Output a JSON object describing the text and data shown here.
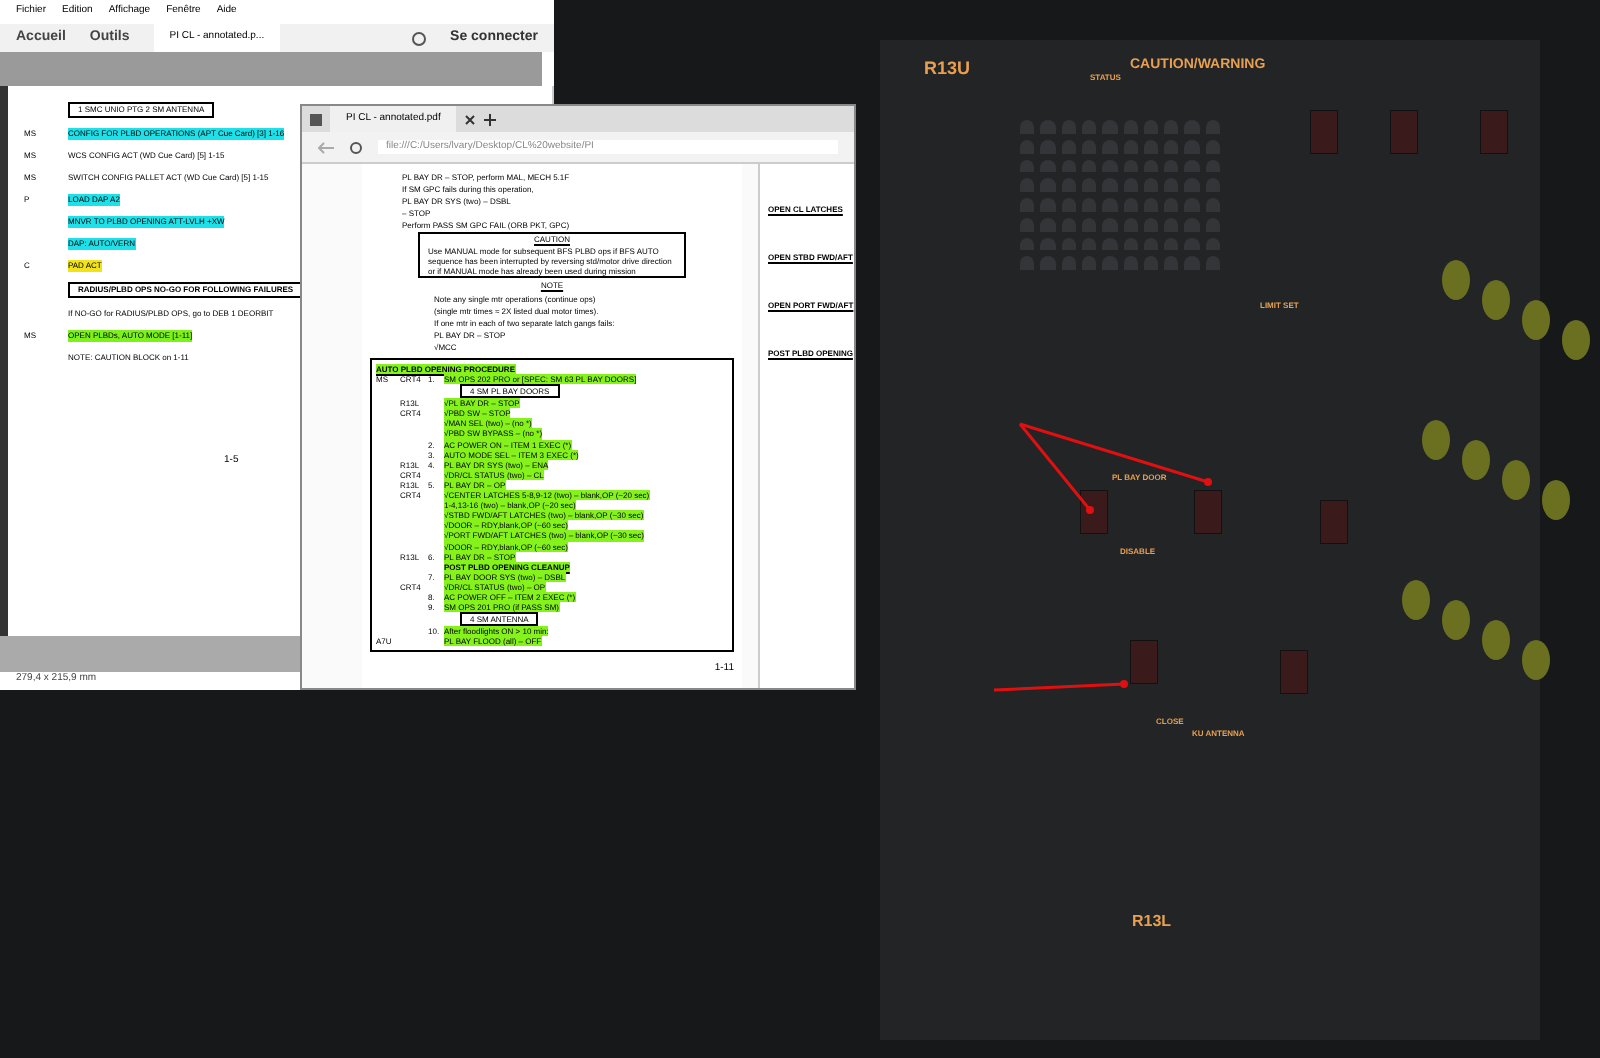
{
  "reader": {
    "menu": [
      "Fichier",
      "Edition",
      "Affichage",
      "Fenêtre",
      "Aide"
    ],
    "nav": [
      {
        "label": "Accueil",
        "selected": false
      },
      {
        "label": "Outils",
        "selected": false
      }
    ],
    "tab": "PI CL - annotated.p...",
    "sign_in": "Se connecter",
    "page": {
      "lines": [
        {
          "kind": "boxed",
          "text": "1  SMC UNIO PTG    2  SM ANTENNA"
        },
        {
          "kind": "cyan",
          "role": "MS",
          "text": "CONFIG FOR PLBD OPERATIONS (APT Cue Card) [3] 1-16"
        },
        {
          "kind": "plain",
          "role": "MS",
          "text": "WCS CONFIG ACT (WD Cue Card) [5] 1-15"
        },
        {
          "kind": "plain",
          "role": "MS",
          "text": "SWITCH CONFIG PALLET ACT (WD Cue Card) [5] 1-15"
        },
        {
          "kind": "cyan",
          "role": "P",
          "text": "LOAD DAP A2"
        },
        {
          "kind": "cyan",
          "text": "MNVR TO PLBD OPENING ATT-LVLH +XW"
        },
        {
          "kind": "cyan",
          "text": "DAP: AUTO/VERN"
        },
        {
          "kind": "yellow",
          "role": "C",
          "text": "PAD ACT"
        },
        {
          "kind": "table",
          "text": "RADIUS/PLBD OPS NO-GO FOR FOLLOWING FAILURES"
        },
        {
          "kind": "plain",
          "text": "If NO-GO for RADIUS/PLBD OPS, go to DEB 1 DEORBIT"
        },
        {
          "kind": "green",
          "role": "MS",
          "text": "OPEN PLBDs, AUTO MODE [1-11]"
        },
        {
          "kind": "plain",
          "text": "NOTE: CAUTION BLOCK on 1-11"
        }
      ],
      "page_number": "1-5"
    },
    "status": "279,4 x 215,9 mm"
  },
  "browser": {
    "tab": "PI CL - annotated.pdf",
    "address": "file:///C:/Users/lvary/Desktop/CL%20website/PI",
    "intro": [
      "PL BAY DR – STOP, perform MAL, MECH 5.1F",
      "If SM GPC fails during this operation,",
      "PL BAY DR SYS (two) – DSBL",
      "– STOP",
      "Perform PASS SM GPC FAIL (ORB PKT, GPC)"
    ],
    "caution": {
      "title": "CAUTION",
      "text": "Use MANUAL mode for subsequent BFS PLBD ops if BFS AUTO sequence has been interrupted by reversing std/motor drive direction or if MANUAL mode has already been used during mission"
    },
    "note": {
      "title": "NOTE",
      "lines": [
        "Note any single mtr operations (continue ops)",
        "(single mtr times ≈ 2X listed dual motor times).",
        "If one mtr in each of two separate latch gangs fails:",
        "PL BAY DR – STOP",
        "√MCC"
      ]
    },
    "procedure": {
      "title": "AUTO PLBD OPENING PROCEDURE",
      "rows": [
        {
          "kind": "step",
          "c1": "MS",
          "c2": "CRT4",
          "n": "1.",
          "text": "SM OPS 202 PRO or [SPEC: SM 63 PL BAY DOORS]"
        },
        {
          "kind": "boxed",
          "text": "4  SM PL BAY DOORS"
        },
        {
          "kind": "step",
          "c2": "R13L",
          "text": "√PL BAY DR – STOP"
        },
        {
          "kind": "step",
          "c2": "CRT4",
          "text": "√PBD SW – STOP"
        },
        {
          "kind": "step",
          "text": "√MAN SEL (two) – (no *)"
        },
        {
          "kind": "step",
          "text": "√PBD SW BYPASS – (no *)"
        },
        {
          "kind": "step",
          "n": "2.",
          "text": "AC POWER ON – ITEM 1 EXEC (*)"
        },
        {
          "kind": "step",
          "n": "3.",
          "text": "AUTO MODE SEL – ITEM 3 EXEC (*)"
        },
        {
          "kind": "step",
          "c2": "R13L",
          "n": "4.",
          "text": "PL BAY DR SYS (two) – ENA"
        },
        {
          "kind": "step",
          "c2": "CRT4",
          "text": "√DR/CL STATUS (two) – CL"
        },
        {
          "kind": "step",
          "c2": "R13L",
          "n": "5.",
          "text": "PL BAY DR – OP"
        },
        {
          "kind": "step",
          "c2": "CRT4",
          "text": "√CENTER LATCHES 5-8,9-12 (two) – blank,OP (~20 sec)"
        },
        {
          "kind": "step",
          "text": "1-4,13-16 (two) – blank,OP (~20 sec)"
        },
        {
          "kind": "step",
          "text": "√STBD FWD/AFT LATCHES (two) – blank,OP (~30 sec)"
        },
        {
          "kind": "step",
          "text": "√DOOR – RDY,blank,OP (~60 sec)"
        },
        {
          "kind": "step",
          "text": "√PORT FWD/AFT LATCHES (two) – blank,OP (~30 sec)"
        },
        {
          "kind": "step",
          "text": "√DOOR – RDY,blank,OP (~60 sec)"
        },
        {
          "kind": "step",
          "c2": "R13L",
          "n": "6.",
          "text": "PL BAY DR – STOP"
        },
        {
          "kind": "heading",
          "text": "POST PLBD OPENING CLEANUP"
        },
        {
          "kind": "step",
          "n": "7.",
          "text": "PL BAY DOOR SYS (two) – DSBL"
        },
        {
          "kind": "step",
          "c2": "CRT4",
          "text": "√DR/CL STATUS (two) – OP"
        },
        {
          "kind": "step",
          "n": "8.",
          "text": "AC POWER OFF – ITEM 2 EXEC (*)"
        },
        {
          "kind": "step",
          "n": "9.",
          "text": "SM OPS 201 PRO (if PASS SM)"
        },
        {
          "kind": "boxed",
          "text": "4  SM ANTENNA"
        },
        {
          "kind": "step",
          "n": "10.",
          "text": "After floodlights ON > 10 min:"
        },
        {
          "kind": "step",
          "c1": "A7U",
          "text": "PL BAY FLOOD (all) – OFF"
        }
      ]
    },
    "side_headings": [
      "OPEN CL LATCHES",
      "OPEN STBD FWD/AFT",
      "OPEN PORT FWD/AFT",
      "POST PLBD OPENING"
    ],
    "page_number": "1-11"
  },
  "cockpit": {
    "labels": [
      "R13U",
      "CAUTION/WARNING",
      "STATUS",
      "LIMIT SET",
      "PL BAY DOOR",
      "DISABLE",
      "CLOSE",
      "KU ANTENNA",
      "R13L"
    ]
  }
}
